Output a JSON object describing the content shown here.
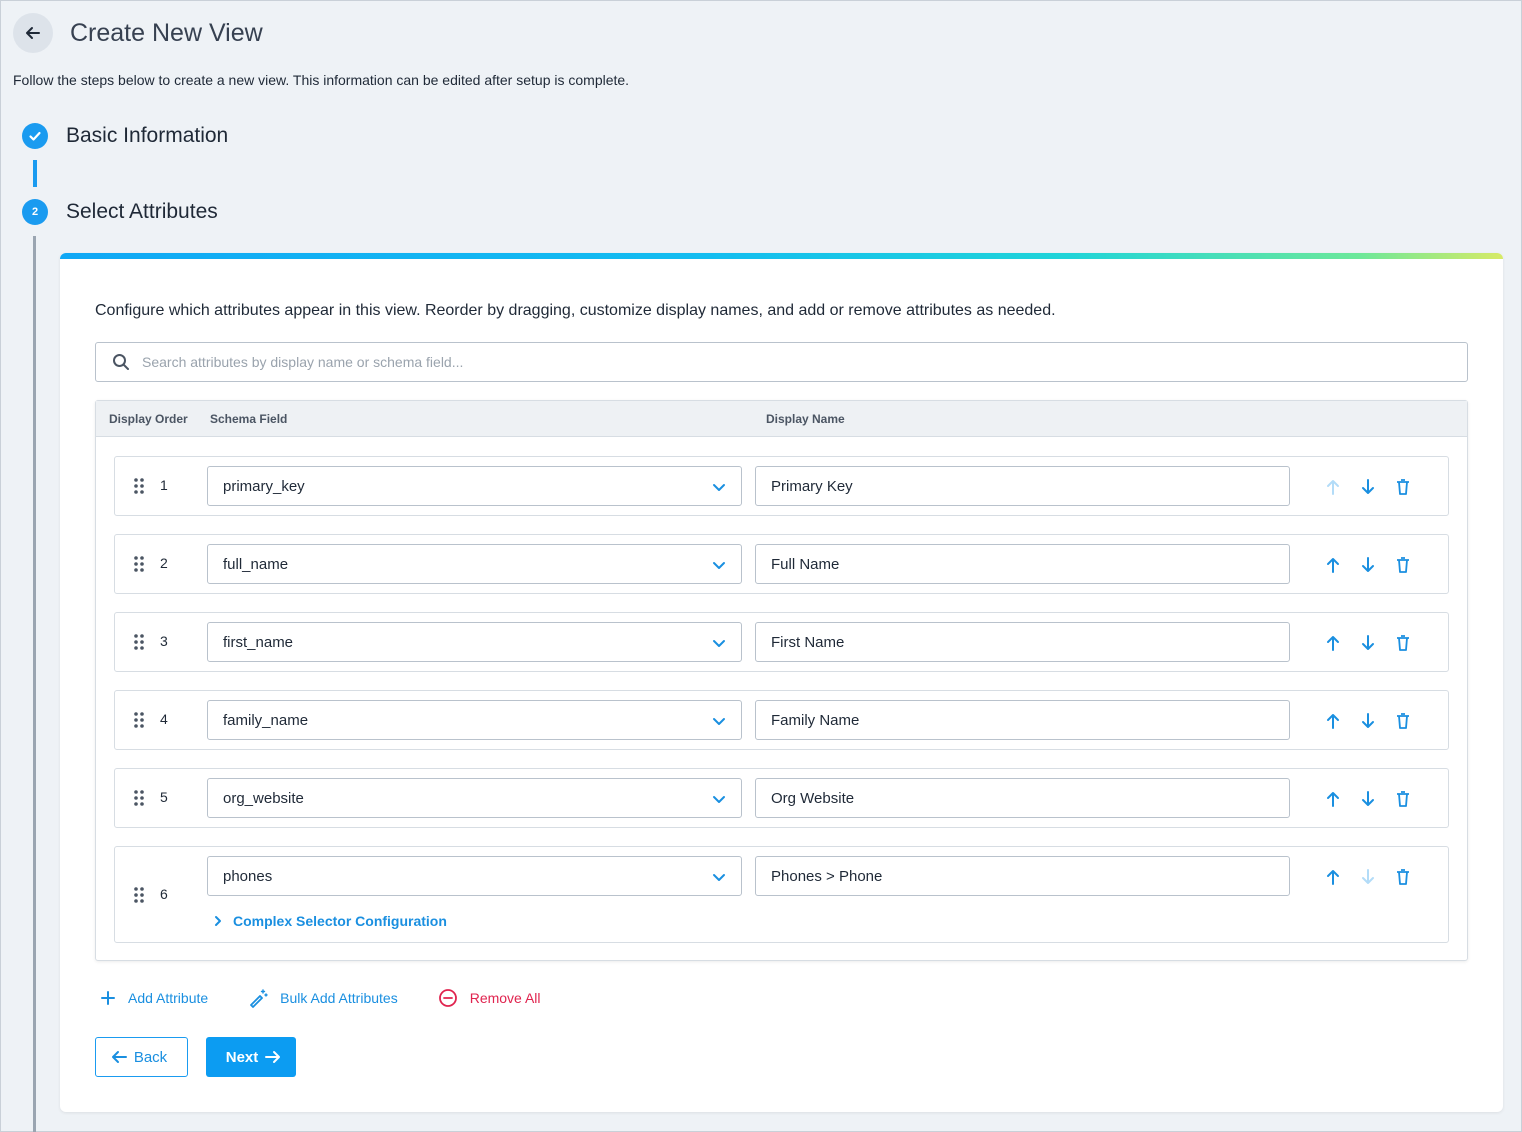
{
  "header": {
    "title": "Create New View",
    "subtitle": "Follow the steps below to create a new view. This information can be edited after setup is complete."
  },
  "steps": [
    {
      "label": "Basic Information",
      "status": "complete"
    },
    {
      "number": "2",
      "label": "Select Attributes",
      "status": "active"
    }
  ],
  "card": {
    "description": "Configure which attributes appear in this view. Reorder by dragging, customize display names, and add or remove attributes as needed.",
    "search_placeholder": "Search attributes by display name or schema field..."
  },
  "table": {
    "headers": {
      "order": "Display Order",
      "schema": "Schema Field",
      "display": "Display Name"
    },
    "rows": [
      {
        "order": "1",
        "schema_field": "primary_key",
        "display_name": "Primary Key"
      },
      {
        "order": "2",
        "schema_field": "full_name",
        "display_name": "Full Name"
      },
      {
        "order": "3",
        "schema_field": "first_name",
        "display_name": "First Name"
      },
      {
        "order": "4",
        "schema_field": "family_name",
        "display_name": "Family Name"
      },
      {
        "order": "5",
        "schema_field": "org_website",
        "display_name": "Org Website"
      },
      {
        "order": "6",
        "schema_field": "phones",
        "display_name": "Phones > Phone",
        "complex_label": "Complex Selector Configuration"
      }
    ]
  },
  "actions": {
    "add": "Add Attribute",
    "bulk_add": "Bulk Add Attributes",
    "remove_all": "Remove All"
  },
  "nav": {
    "back": "Back",
    "next": "Next"
  },
  "colors": {
    "accent": "#1a9bf0",
    "danger": "#e0244f",
    "disabled": "#b3dcf8"
  }
}
